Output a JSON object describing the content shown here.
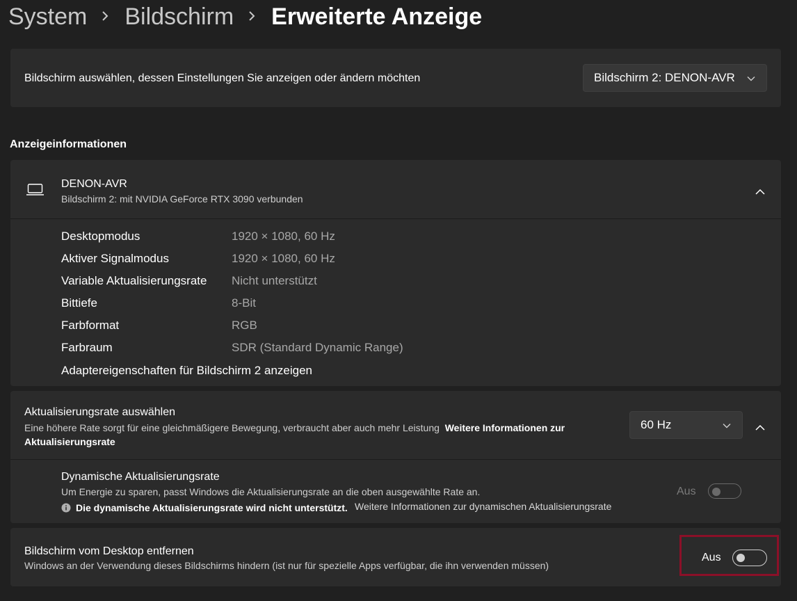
{
  "breadcrumb": {
    "items": [
      "System",
      "Bildschirm"
    ],
    "current": "Erweiterte Anzeige"
  },
  "display_select": {
    "label": "Bildschirm auswählen, dessen Einstellungen Sie anzeigen oder ändern möchten",
    "value": "Bildschirm 2: DENON-AVR"
  },
  "display_info": {
    "section_title": "Anzeigeinformationen",
    "name": "DENON-AVR",
    "subtitle": "Bildschirm 2: mit NVIDIA GeForce RTX 3090 verbunden",
    "rows": [
      {
        "label": "Desktopmodus",
        "value": "1920 × 1080, 60 Hz"
      },
      {
        "label": "Aktiver Signalmodus",
        "value": "1920 × 1080, 60 Hz"
      },
      {
        "label": "Variable Aktualisierungsrate",
        "value": "Nicht unterstützt"
      },
      {
        "label": "Bittiefe",
        "value": "8-Bit"
      },
      {
        "label": "Farbformat",
        "value": "RGB"
      },
      {
        "label": "Farbraum",
        "value": "SDR (Standard Dynamic Range)"
      }
    ],
    "adapter_link": "Adaptereigenschaften für Bildschirm 2 anzeigen"
  },
  "refresh_rate": {
    "title": "Aktualisierungsrate auswählen",
    "description": "Eine höhere Rate sorgt für eine gleichmäßigere Bewegung, verbraucht aber auch mehr Leistung",
    "link_line1": "Weitere Informationen zur",
    "link_line2": "Aktualisierungsrate",
    "value": "60 Hz"
  },
  "dynamic_refresh": {
    "title": "Dynamische Aktualisierungsrate",
    "description": "Um Energie zu sparen, passt Windows die Aktualisierungsrate an die oben ausgewählte Rate an.",
    "info_note": "Die dynamische Aktualisierungsrate wird nicht unterstützt.",
    "info_link": "Weitere Informationen zur dynamischen Aktualisierungsrate",
    "toggle_label": "Aus",
    "enabled": false
  },
  "remove_display": {
    "title": "Bildschirm vom Desktop entfernen",
    "description": "Windows an der Verwendung dieses Bildschirms hindern (ist nur für spezielle Apps verfügbar, die ihn verwenden müssen)",
    "toggle_label": "Aus",
    "enabled": false
  },
  "colors": {
    "background": "#202020",
    "card": "#2b2b2b",
    "highlight_border": "#8b1028"
  },
  "icons": [
    "chevron-right-icon",
    "chevron-down-icon",
    "chevron-up-icon",
    "laptop-icon",
    "info-icon"
  ]
}
